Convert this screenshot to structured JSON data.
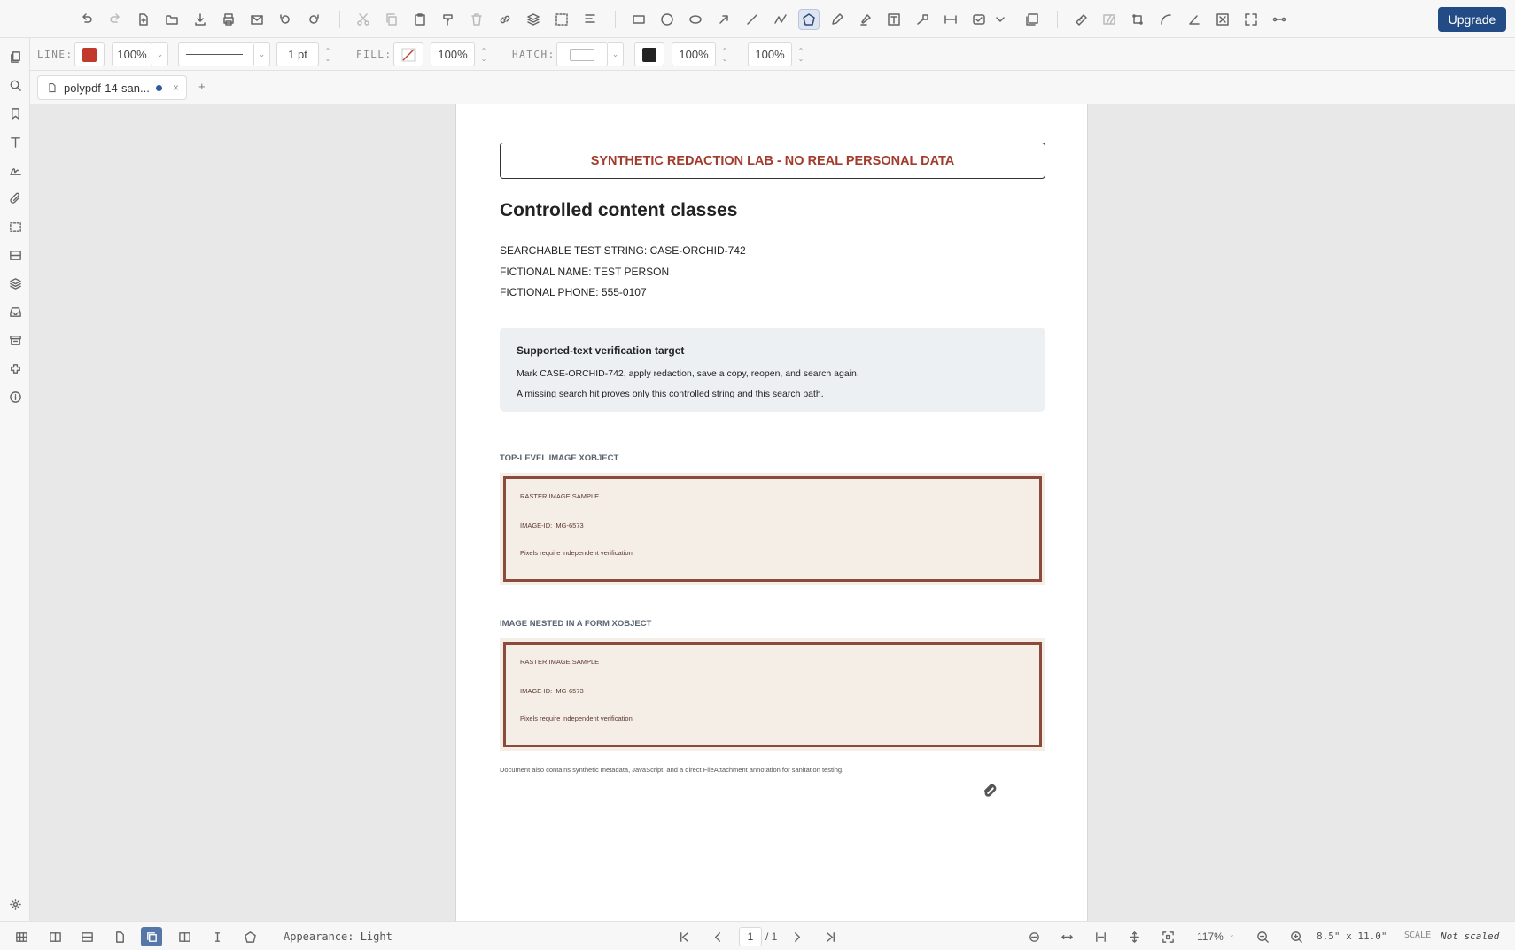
{
  "toolbar": {
    "upgrade_label": "Upgrade"
  },
  "props": {
    "line_label": "LINE:",
    "line_color": "#c0392b",
    "line_opacity": "100%",
    "line_width": "1 pt",
    "fill_label": "FILL:",
    "fill_opacity": "100%",
    "hatch_label": "HATCH:",
    "hatch_color": "#222222",
    "opacity_a": "100%",
    "opacity_b": "100%"
  },
  "tabs": {
    "doc_name": "polypdf-14-san...",
    "close": "×",
    "add": "+"
  },
  "document": {
    "banner": "SYNTHETIC REDACTION LAB - NO REAL PERSONAL DATA",
    "heading": "Controlled content classes",
    "lines": [
      "SEARCHABLE TEST STRING: CASE-ORCHID-742",
      "FICTIONAL NAME: TEST PERSON",
      "FICTIONAL PHONE: 555-0107"
    ],
    "info_title": "Supported-text verification target",
    "info_lines": [
      "Mark CASE-ORCHID-742, apply redaction, save a copy, reopen, and search again.",
      "A missing search hit proves only this controlled string and this search path."
    ],
    "section1": "TOP-LEVEL IMAGE XOBJECT",
    "section2": "IMAGE NESTED IN A FORM XOBJECT",
    "image_lines": [
      "RASTER IMAGE SAMPLE",
      "IMAGE-ID: IMG-6573",
      "Pixels require independent verification"
    ],
    "footnote": "Document also contains synthetic metadata, JavaScript, and a direct FileAttachment annotation for sanitation testing."
  },
  "status": {
    "appearance": "Appearance: Light",
    "page_current": "1",
    "page_total": "/ 1",
    "zoom": "117%",
    "page_size": "8.5\" x 11.0\"",
    "scale_label": "SCALE",
    "scale_value": "Not scaled"
  }
}
